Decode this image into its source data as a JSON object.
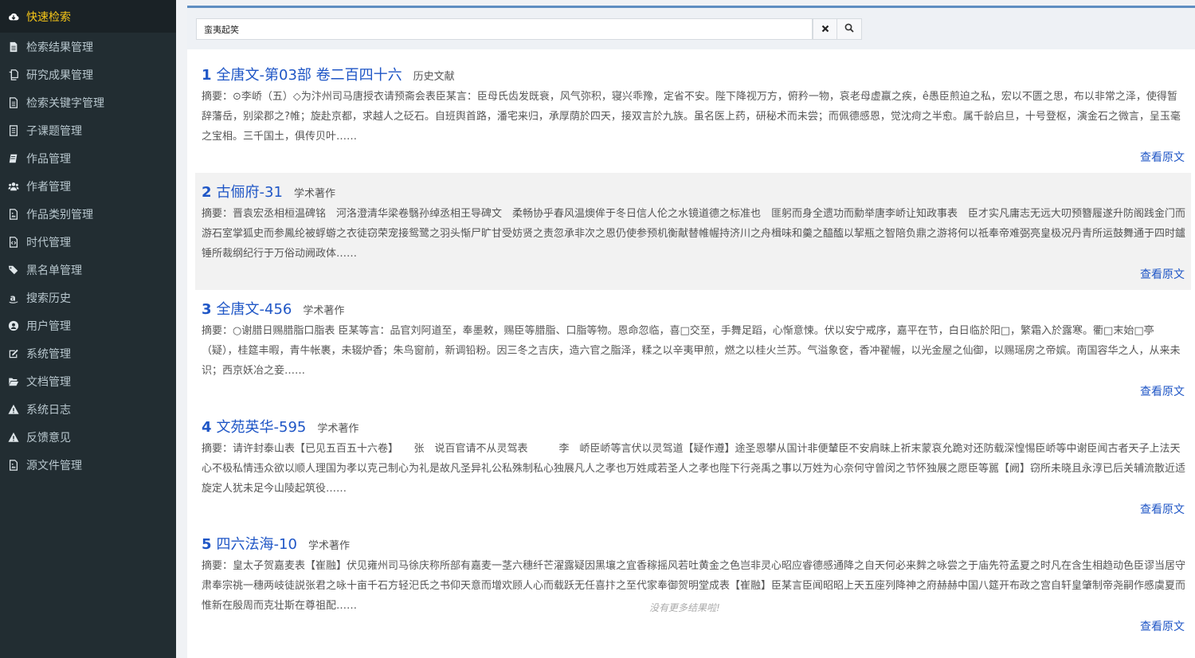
{
  "sidebar": {
    "items": [
      {
        "label": "快速检索",
        "icon": "cloud-icon",
        "active": true
      },
      {
        "label": "检索结果管理",
        "icon": "file-icon"
      },
      {
        "label": "研究成果管理",
        "icon": "copy-icon"
      },
      {
        "label": "检索关键字管理",
        "icon": "file-text-icon"
      },
      {
        "label": "子课题管理",
        "icon": "list-icon"
      },
      {
        "label": "作品管理",
        "icon": "book-icon"
      },
      {
        "label": "作者管理",
        "icon": "users-icon"
      },
      {
        "label": "作品类别管理",
        "icon": "file-image-icon"
      },
      {
        "label": "时代管理",
        "icon": "file-code-icon"
      },
      {
        "label": "黑名单管理",
        "icon": "tags-icon"
      },
      {
        "label": "搜索历史",
        "icon": "amazon-icon"
      },
      {
        "label": "用户管理",
        "icon": "user-circle-icon"
      },
      {
        "label": "系统管理",
        "icon": "edit-icon"
      },
      {
        "label": "文档管理",
        "icon": "folder-open-icon"
      },
      {
        "label": "系统日志",
        "icon": "warning-icon"
      },
      {
        "label": "反馈意见",
        "icon": "warning-icon"
      },
      {
        "label": "源文件管理",
        "icon": "file-image-icon"
      }
    ]
  },
  "search": {
    "value": "蛮夷起笑",
    "clear_icon": "times-icon",
    "search_icon": "search-icon"
  },
  "results": [
    {
      "num": "1",
      "title": "全唐文-第03部 卷二百四十六",
      "category": "历史文献",
      "abstract": "摘要：⊙李峤（五）◇为汴州司马唐授衣请预斋会表臣某言：臣母氏齿发既衰，风气弥积，寝兴乖豫，定省不安。陛下降视万方，俯矜一物，哀老母虚羸之疾，ê愚臣煎迫之私，宏以不匮之思，布以非常之泽，使得暂辞藩岳，别梁郡之?帷；旋赴京都，求越人之砭石。自班舆首路，潘宅来归，承厚荫於四天，接双言於九族。虽名医上药，研秘术而未尝；而佩德感恩，觉沈疴之半愈。属千龄启旦，十号登枢，演金石之微言，呈玉毫之宝相。三千国土，俱传贝叶……",
      "link": "查看原文"
    },
    {
      "num": "2",
      "title": "古俪府-31",
      "category": "学术著作",
      "abstract": "摘要：晋袁宏丞相桓温碑铭　河洛澄清华梁卷翳孙绰丞相王导碑文　柔畅协乎春风温燠侔于冬日信人伦之水镜道德之标准也　匪躬而身全遗功而勳举唐李峤让知政事表　臣才实凡庸志无远大叨预簪履遂升防阁践金门而游石室掌狐史而参鳳纶被蜉蝣之衣徒窃荣宠接鸳鹭之羽头惭尸旷甘受妨贤之责忽承非次之恩仍使参预机衡献替帷幄持济川之舟楫味和羹之醯醢以挈瓶之智陪负鼎之游将何以祗奉帝难弼亮皇极况丹青所运鼓舞通于四时鑪锤所裁纲纪行于万俗动阙政体……",
      "link": "查看原文"
    },
    {
      "num": "3",
      "title": "全唐文-456",
      "category": "学术著作",
      "abstract": "摘要：○谢腊日赐腊脂口脂表 臣某等言：品官刘阿道至，奉墨敕，赐臣等腊脂、口脂等物。恩命忽临，喜□交至，手舞足蹈，心惭意悚。伏以安宁戒序，嘉平在节，白日临於阳□，繁霜入於露寒。衢□末始□亭（疑），桂筵丰暇，青牛帐裹，未辍炉香；朱鸟窗前，新调铅粉。因三冬之吉庆，造六官之脂泽，糅之以辛夷甲煎，燃之以桂火兰苏。气溢象奁，香冲翟幄，以光金屋之仙御，以赐瑶房之帝嫔。南国容华之人，从来未识；西京妖冶之妾……",
      "link": "查看原文"
    },
    {
      "num": "4",
      "title": "文苑英华-595",
      "category": "学术著作",
      "abstract": "摘要：请许封泰山表【已见五百五十六卷】　　张　说百官请不从灵驾表　　　李　峤臣峤等言伏以灵驾道【疑作遵】途圣恩攀从国计非便輦臣不安肩昧上祈末蒙哀允跪对还防载深惶惕臣峤等中谢臣闻古者天子上法天心不极私情违众欲以顺人理国为孝以克己制心为礼是故凡圣异礼公私殊制私心独展凡人之孝也万姓咸若圣人之孝也陛下行尧禹之事以万姓为心奈何守曾闵之节怀独展之愿臣等嚚【阙】窃所未晓且永淳已后关辅流散近适旋定人犹未足今山陵起筑役……",
      "link": "查看原文"
    },
    {
      "num": "5",
      "title": "四六法海-10",
      "category": "学术著作",
      "abstract": "摘要：皇太子贺嘉麦表【崔融】伏见雍州司马徐庆称所部有嘉麦一茎六穗纤芒濯露疑因黑壤之宜香稼摇风若吐黄金之色岂非灵心昭应睿德感通降之自天何必来麰之咏尝之于庙先符孟夏之时凡在含生相趋动色臣谬当居守肃奉宗祧一穗两岐徒説张君之咏十亩千石方轻汜氏之书仰天意而增欢顾人心而载跃无任喜抃之至代家奉御贺明堂成表【崔融】臣某言臣闻昭昭上天五座列降神之府赫赫中国八筵开布政之宫自轩皇肇制帝尧嗣作慼虞夏而惟新在殷周而克壮斯在尊祖配……",
      "link": "查看原文"
    }
  ],
  "footer_note": "没有更多结果啦!"
}
